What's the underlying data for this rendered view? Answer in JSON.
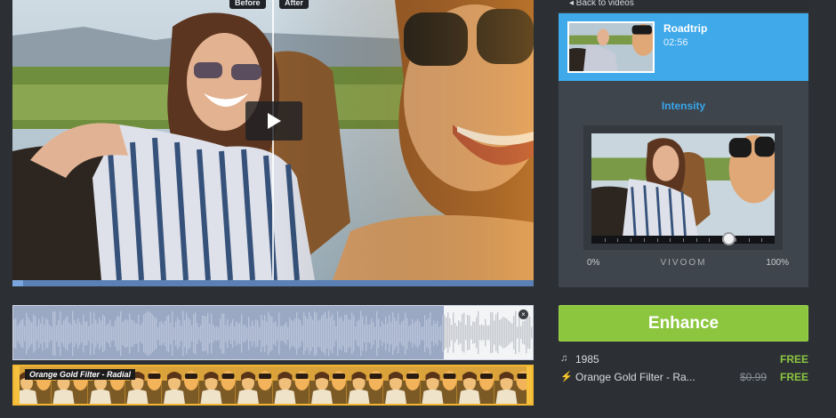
{
  "preview": {
    "before_label": "Before",
    "after_label": "After",
    "play_icon": "play-icon",
    "progress": 0.02
  },
  "audio": {
    "close_icon": "close-icon"
  },
  "filter_strip": {
    "label": "Orange Gold Filter - Radial"
  },
  "panel": {
    "back_label": "◂ Back to videos",
    "video": {
      "title": "Roadtrip",
      "duration": "02:56"
    },
    "intensity": {
      "label": "Intensity",
      "min_label": "0%",
      "max_label": "100%",
      "brand": "VIVOOM",
      "value": 0.75
    }
  },
  "enhance_label": "Enhance",
  "purchases": [
    {
      "icon": "music-note-icon",
      "glyph": "♫",
      "name": "1985",
      "old_price": "",
      "price": "FREE"
    },
    {
      "icon": "magic-wand-icon",
      "glyph": "⚡",
      "name": "Orange Gold Filter - Ra...",
      "old_price": "$0.99",
      "price": "FREE"
    }
  ],
  "colors": {
    "accent_blue": "#3fa9ea",
    "enhance_green": "#8cc63f",
    "filter_orange": "#e7a82a",
    "free_green": "#8cc63f"
  }
}
